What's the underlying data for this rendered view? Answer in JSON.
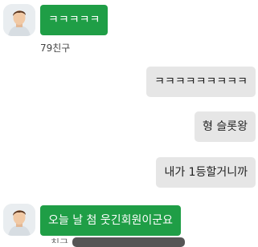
{
  "messages": [
    {
      "direction": "in",
      "text": "ㅋㅋㅋㅋㅋ",
      "sender": "79친구"
    },
    {
      "direction": "out",
      "text": "ㅋㅋㅋㅋㅋㅋㅋㅋㅋ"
    },
    {
      "direction": "out",
      "text": "형 슬롯왕"
    },
    {
      "direction": "out",
      "text": "내가 1등할거니까"
    },
    {
      "direction": "in",
      "text": "오늘 날 첨 웃긴회원이군요",
      "sender": "친구"
    }
  ],
  "colors": {
    "incoming_bubble": "#1f9e46",
    "outgoing_bubble": "#e6e6e6"
  }
}
